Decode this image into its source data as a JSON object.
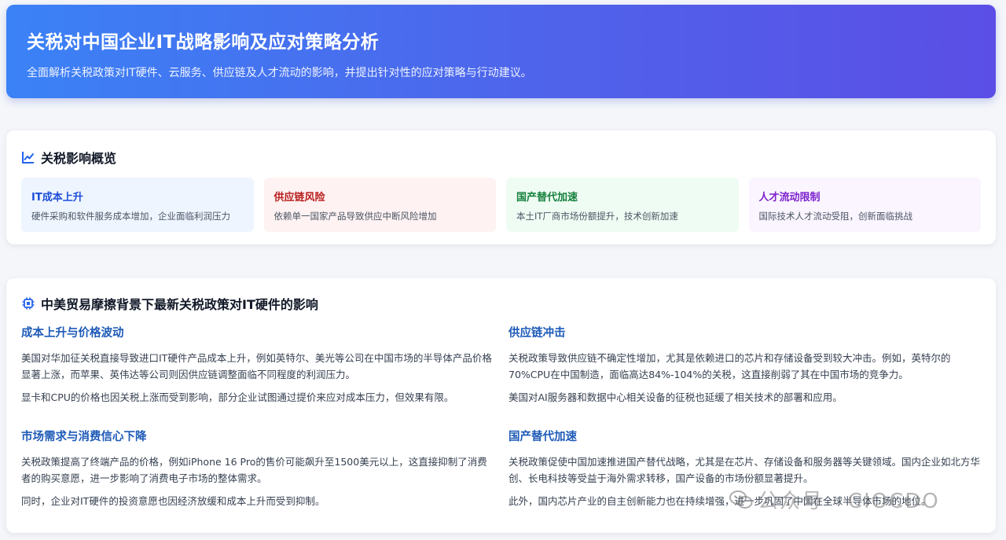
{
  "header": {
    "title": "关税对中国企业IT战略影响及应对策略分析",
    "subtitle": "全面解析关税政策对IT硬件、云服务、供应链及人才流动的影响，并提出针对性的应对策略与行动建议。"
  },
  "overview": {
    "title": "关税影响概览",
    "icon": "chart-line-icon",
    "tiles": [
      {
        "title": "IT成本上升",
        "desc": "硬件采购和软件服务成本增加，企业面临利润压力",
        "color": "#1d4ed8"
      },
      {
        "title": "供应链风险",
        "desc": "依赖单一国家产品导致供应中断风险增加",
        "color": "#b91c1c"
      },
      {
        "title": "国产替代加速",
        "desc": "本土IT厂商市场份额提升，技术创新加速",
        "color": "#15803d"
      },
      {
        "title": "人才流动限制",
        "desc": "国际技术人才流动受阻，创新面临挑战",
        "color": "#7e22ce"
      }
    ]
  },
  "impact": {
    "title": "中美贸易摩擦背景下最新关税政策对IT硬件的影响",
    "icon": "chip-icon",
    "sections": [
      {
        "title": "成本上升与价格波动",
        "p1": "美国对华加征关税直接导致进口IT硬件产品成本上升，例如英特尔、美光等公司在中国市场的半导体产品价格显著上涨，而苹果、英伟达等公司则因供应链调整面临不同程度的利润压力。",
        "p2": "显卡和CPU的价格也因关税上涨而受到影响，部分企业试图通过提价来应对成本压力，但效果有限。"
      },
      {
        "title": "供应链冲击",
        "p1": "关税政策导致供应链不确定性增加，尤其是依赖进口的芯片和存储设备受到较大冲击。例如，英特尔的70%CPU在中国制造，面临高达84%-104%的关税，这直接削弱了其在中国市场的竞争力。",
        "p2": "美国对AI服务器和数据中心相关设备的征税也延缓了相关技术的部署和应用。"
      },
      {
        "title": "市场需求与消费信心下降",
        "p1": "关税政策提高了终端产品的价格，例如iPhone 16 Pro的售价可能飙升至1500美元以上，这直接抑制了消费者的购买意愿，进一步影响了消费电子市场的整体需求。",
        "p2": "同时，企业对IT硬件的投资意愿也因经济放缓和成本上升而受到抑制。"
      },
      {
        "title": "国产替代加速",
        "p1": "关税政策促使中国加速推进国产替代战略，尤其是在芯片、存储设备和服务器等关键领域。国内企业如北方华创、长电科技等受益于海外需求转移，国产设备的市场份额显著提升。",
        "p2": "此外，国内芯片产业的自主创新能力也在持续增强，进一步巩固了中国在全球半导体市场的地位。"
      }
    ]
  },
  "watermark": {
    "text": "公众号 · CIOCDO",
    "icon": "wechat-icon"
  }
}
